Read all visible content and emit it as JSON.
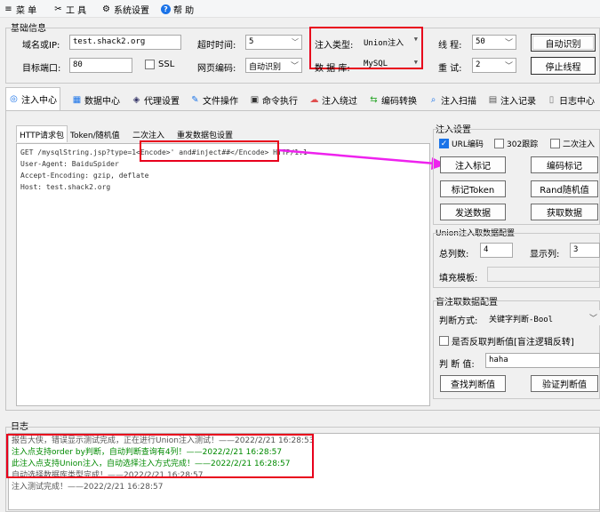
{
  "menu": [
    {
      "icon": "≡",
      "label": "菜 单"
    },
    {
      "icon": "✂",
      "label": "工 具"
    },
    {
      "icon": "⚙",
      "label": "系统设置"
    },
    {
      "icon": "?",
      "label": "帮 助"
    }
  ],
  "basic": {
    "title": "基础信息",
    "domain_label": "域名或IP:",
    "domain_value": "test.shack2.org",
    "port_label": "目标端口:",
    "port_value": "80",
    "ssl_label": "SSL",
    "timeout_label": "超时时间:",
    "timeout_value": "5",
    "encoding_label": "网页编码:",
    "encoding_value": "自动识别",
    "inject_type_label": "注入类型:",
    "inject_type_value": "Union注入",
    "db_label": "数 据 库:",
    "db_value": "MySQL",
    "threads_label": "线 程:",
    "threads_value": "50",
    "retry_label": "重 试:",
    "retry_value": "2",
    "auto_detect_btn": "自动识别",
    "stop_threads_btn": "停止线程"
  },
  "tabs": [
    {
      "icon": "◎",
      "label": "注入中心"
    },
    {
      "icon": "▦",
      "label": "数据中心"
    },
    {
      "icon": "◈",
      "label": "代理设置"
    },
    {
      "icon": "✎",
      "label": "文件操作"
    },
    {
      "icon": "▣",
      "label": "命令执行"
    },
    {
      "icon": "☁",
      "label": "注入绕过"
    },
    {
      "icon": "⇆",
      "label": "编码转换"
    },
    {
      "icon": "⌕",
      "label": "注入扫描"
    },
    {
      "icon": "▤",
      "label": "注入记录"
    },
    {
      "icon": "▯",
      "label": "日志中心"
    }
  ],
  "subtabs": [
    "HTTP请求包",
    "Token/随机值",
    "二次注入",
    "重发数据包设置"
  ],
  "request": {
    "line1_pre": "GET /mysqlString.jsp?type=1",
    "line1_mid": "<Encode>' and#inject##</Encode>",
    "line1_post": " HTTP/1.1",
    "line2": "User-Agent: BaiduSpider",
    "line3": "Accept-Encoding: gzip, deflate",
    "line4": "Host: test.shack2.org"
  },
  "inject_settings": {
    "title": "注入设置",
    "url_encode_label": "URL编码",
    "follow302_label": "302跟踪",
    "second_inject_label": "二次注入",
    "btn_mark": "注入标记",
    "btn_encode_mark": "编码标记",
    "btn_token_mark": "标记Token",
    "btn_rand_mark": "Rand随机值",
    "btn_send": "发送数据",
    "btn_fetch": "获取数据"
  },
  "union_cfg": {
    "title": "Union注入取数据配置",
    "cols_label": "总列数:",
    "cols_value": "4",
    "show_label": "显示列:",
    "show_value": "3",
    "template_label": "填充模板:",
    "template_value": ""
  },
  "blind_cfg": {
    "title": "盲注取数据配置",
    "judge_label": "判断方式:",
    "judge_value": "关键字判断-Bool",
    "reverse_label": "是否反取判断值[盲注逻辑反转]",
    "value_label": "判 断 值:",
    "value_value": "haha",
    "btn_find": "查找判断值",
    "btn_verify": "验证判断值"
  },
  "log": {
    "title": "日志",
    "lines": [
      {
        "text": "报告大侠，错误显示测试完成，正在进行Union注入测试！——2022/2/21 16:28:53",
        "color": "#555555"
      },
      {
        "text": "注入点支持order by判断，自动判断查询有4列！——2022/2/21 16:28:57",
        "color": "#008a00"
      },
      {
        "text": "此注入点支持Union注入，自动选择注入方式完成！——2022/2/21 16:28:57",
        "color": "#008a00"
      },
      {
        "text": "自动选择数据库类型完成！——2022/2/21 16:28:57",
        "color": "#555555"
      },
      {
        "text": "注入测试完成！——2022/2/21 16:28:57",
        "color": "#555555"
      }
    ]
  },
  "colors": {
    "highlight": "#e8001c",
    "arrow": "#ee22ee",
    "ok": "#008a00"
  }
}
